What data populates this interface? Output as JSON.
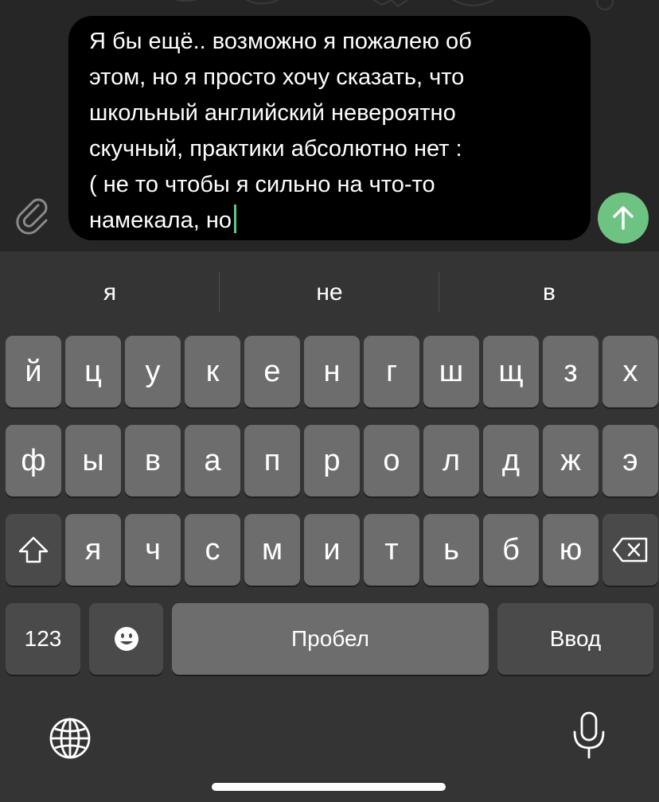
{
  "compose": {
    "message_text": "Я бы ещё.. возможно я пожалею об\nэтом, но я просто хочу сказать, что\nшкольный английский невероятно\nскучный, практики абсолютно нет :\n( не то чтобы я сильно на что-то\nнамекала, но",
    "attach_icon": "paperclip-icon",
    "send_icon": "arrow-up-icon",
    "send_color": "#6ec383",
    "caret_color": "#5fc97f"
  },
  "suggestions": [
    "я",
    "не",
    "в"
  ],
  "keyboard": {
    "row1": [
      "й",
      "ц",
      "у",
      "к",
      "е",
      "н",
      "г",
      "ш",
      "щ",
      "з",
      "х"
    ],
    "row2": [
      "ф",
      "ы",
      "в",
      "а",
      "п",
      "р",
      "о",
      "л",
      "д",
      "ж",
      "э"
    ],
    "row3": [
      "я",
      "ч",
      "с",
      "м",
      "и",
      "т",
      "ь",
      "б",
      "ю"
    ],
    "numbers_label": "123",
    "space_label": "Пробел",
    "return_label": "Ввод",
    "shift_icon": "shift-icon",
    "delete_icon": "backspace-icon",
    "emoji_icon": "emoji-icon",
    "globe_icon": "globe-icon",
    "mic_icon": "microphone-icon"
  }
}
